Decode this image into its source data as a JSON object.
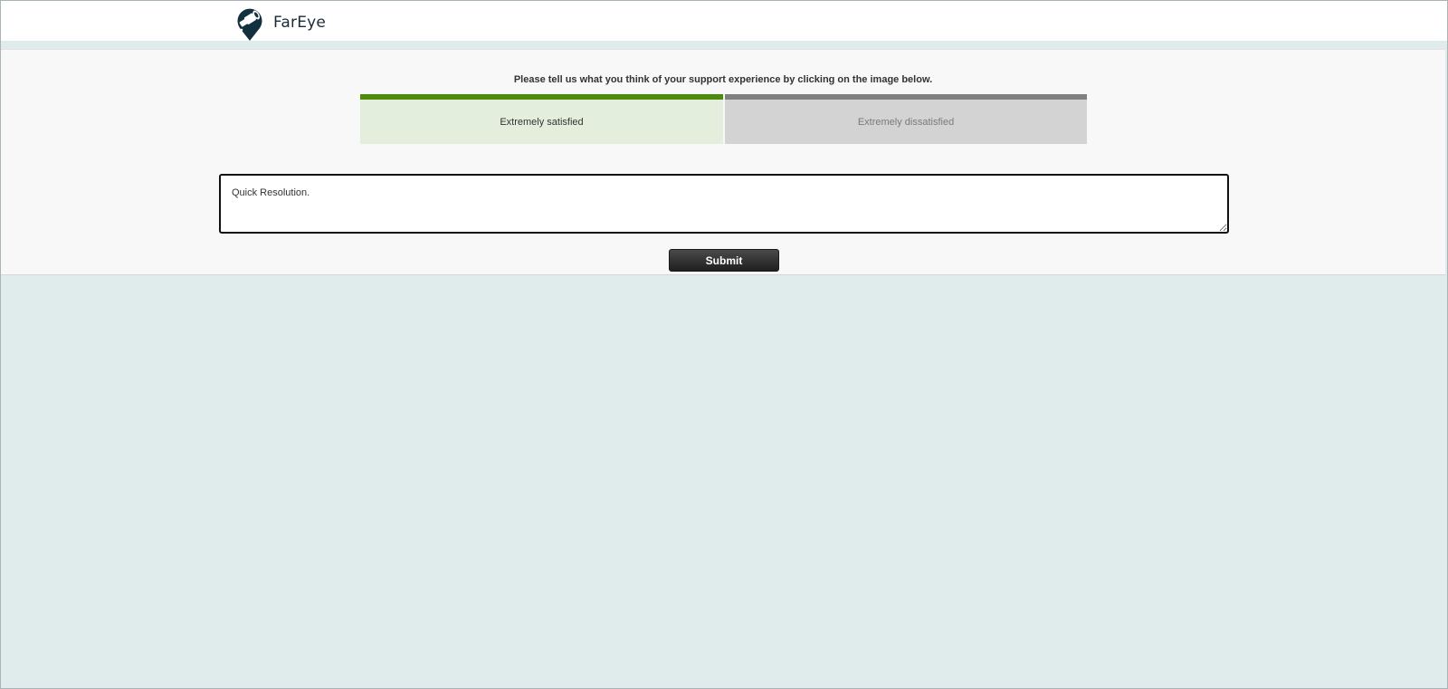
{
  "header": {
    "logo_text": "FarEye",
    "logo_icon": "fareye-logo-icon"
  },
  "survey": {
    "prompt": "Please tell us what you think of your support experience by clicking on the image below.",
    "options": [
      {
        "label": "Extremely satisfied",
        "accent": "#4d8a0e",
        "selected": true
      },
      {
        "label": "Extremely dissatisfied",
        "accent": "#808080",
        "selected": false
      }
    ],
    "comment_value": "Quick Resolution.",
    "submit_label": "Submit"
  },
  "colors": {
    "page_background": "#e0ebec",
    "panel_background": "#f8f8f8",
    "satisfied_fill": "#e3eedc",
    "dissatisfied_fill": "#d3d3d3"
  }
}
